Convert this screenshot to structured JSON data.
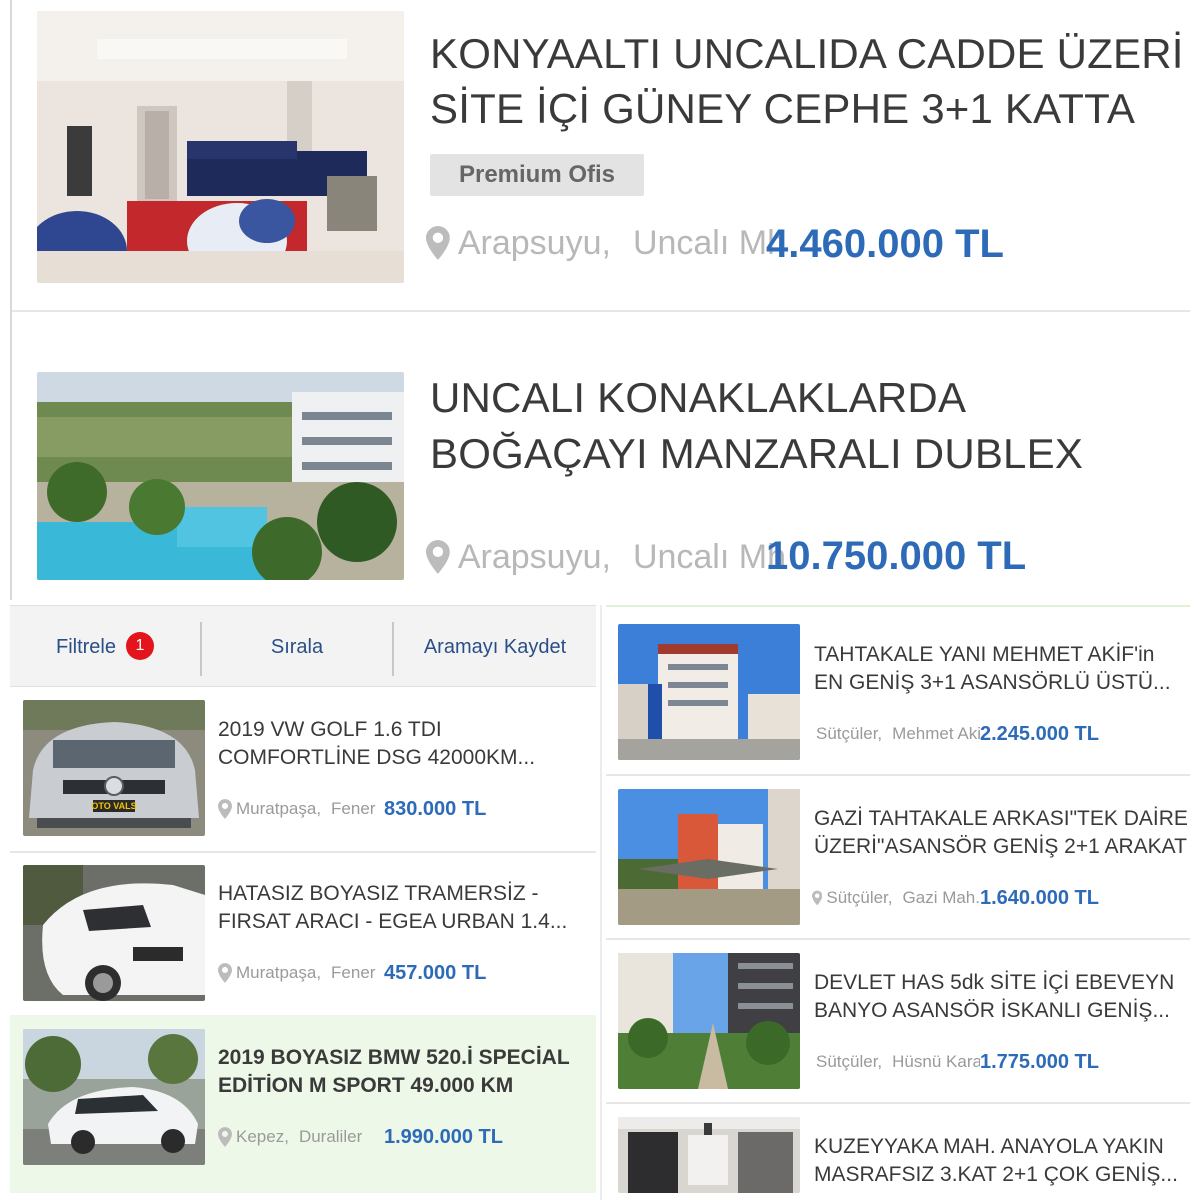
{
  "top_listings": [
    {
      "title_line1": "KONYAALTI UNCALIDA CADDE ÜZERİ",
      "title_line2": "SİTE İÇİ GÜNEY CEPHE 3+1 KATTA",
      "badge": "Premium Ofis",
      "district": "Arapsuyu,",
      "neighborhood": "Uncalı Mh",
      "price": "4.460.000 TL"
    },
    {
      "title_line1": "UNCALI KONAKLAKLARDA",
      "title_line2": "BOĞAÇAYI MANZARALI DUBLEX",
      "district": "Arapsuyu,",
      "neighborhood": "Uncalı Mh",
      "price": "10.750.000 TL"
    }
  ],
  "filterbar": {
    "filter_label": "Filtrele",
    "filter_count": "1",
    "sort_label": "Sırala",
    "save_label": "Aramayı Kaydet"
  },
  "car_listings": [
    {
      "title_line1": "2019 VW GOLF 1.6 TDI",
      "title_line2": "COMFORTLİNE DSG 42000KM...",
      "district": "Muratpaşa,",
      "neighborhood": "Fener",
      "price": "830.000 TL",
      "plate": "OTO VALS"
    },
    {
      "title_line1": "HATASIZ BOYASIZ TRAMERSİZ -",
      "title_line2": "FIRSAT ARACI - EGEA URBAN 1.4...",
      "district": "Muratpaşa,",
      "neighborhood": "Fener",
      "price": "457.000 TL"
    },
    {
      "title_line1": "2019 BOYASIZ BMW 520.İ SPECİAL",
      "title_line2": "EDİTİON M SPORT 49.000 KM",
      "district": "Kepez,",
      "neighborhood": "Duraliler",
      "price": "1.990.000 TL"
    }
  ],
  "home_listings": [
    {
      "title_line1": "TAHTAKALE YANI MEHMET AKİF'in",
      "title_line2": "EN GENİŞ 3+1 ASANSÖRLÜ ÜSTÜ...",
      "district": "Sütçüler,",
      "neighborhood": "Mehmet Akif",
      "price": "2.245.000 TL"
    },
    {
      "title_line1": "GAZİ TAHTAKALE ARKASI\"TEK DAİRE",
      "title_line2": "ÜZERİ\"ASANSÖR GENİŞ 2+1 ARAKAT",
      "district": "Sütçüler,",
      "neighborhood": "Gazi Mah.",
      "price": "1.640.000 TL"
    },
    {
      "title_line1": "DEVLET HAS 5dk SİTE İÇİ EBEVEYN",
      "title_line2": "BANYO ASANSÖR İSKANLI GENİŞ...",
      "district": "Sütçüler,",
      "neighborhood": "Hüsnü Karakaş",
      "price": "1.775.000 TL"
    },
    {
      "title_line1": "KUZEYYAKA MAH. ANAYOLA YAKIN",
      "title_line2": "MASRAFSIZ 3.KAT 2+1 ÇOK GENİŞ..."
    }
  ],
  "colors": {
    "price_blue": "#2d6bb8",
    "badge_red": "#e4141c",
    "highlight_green": "#eef8e8",
    "filter_text": "#2a4f86"
  }
}
